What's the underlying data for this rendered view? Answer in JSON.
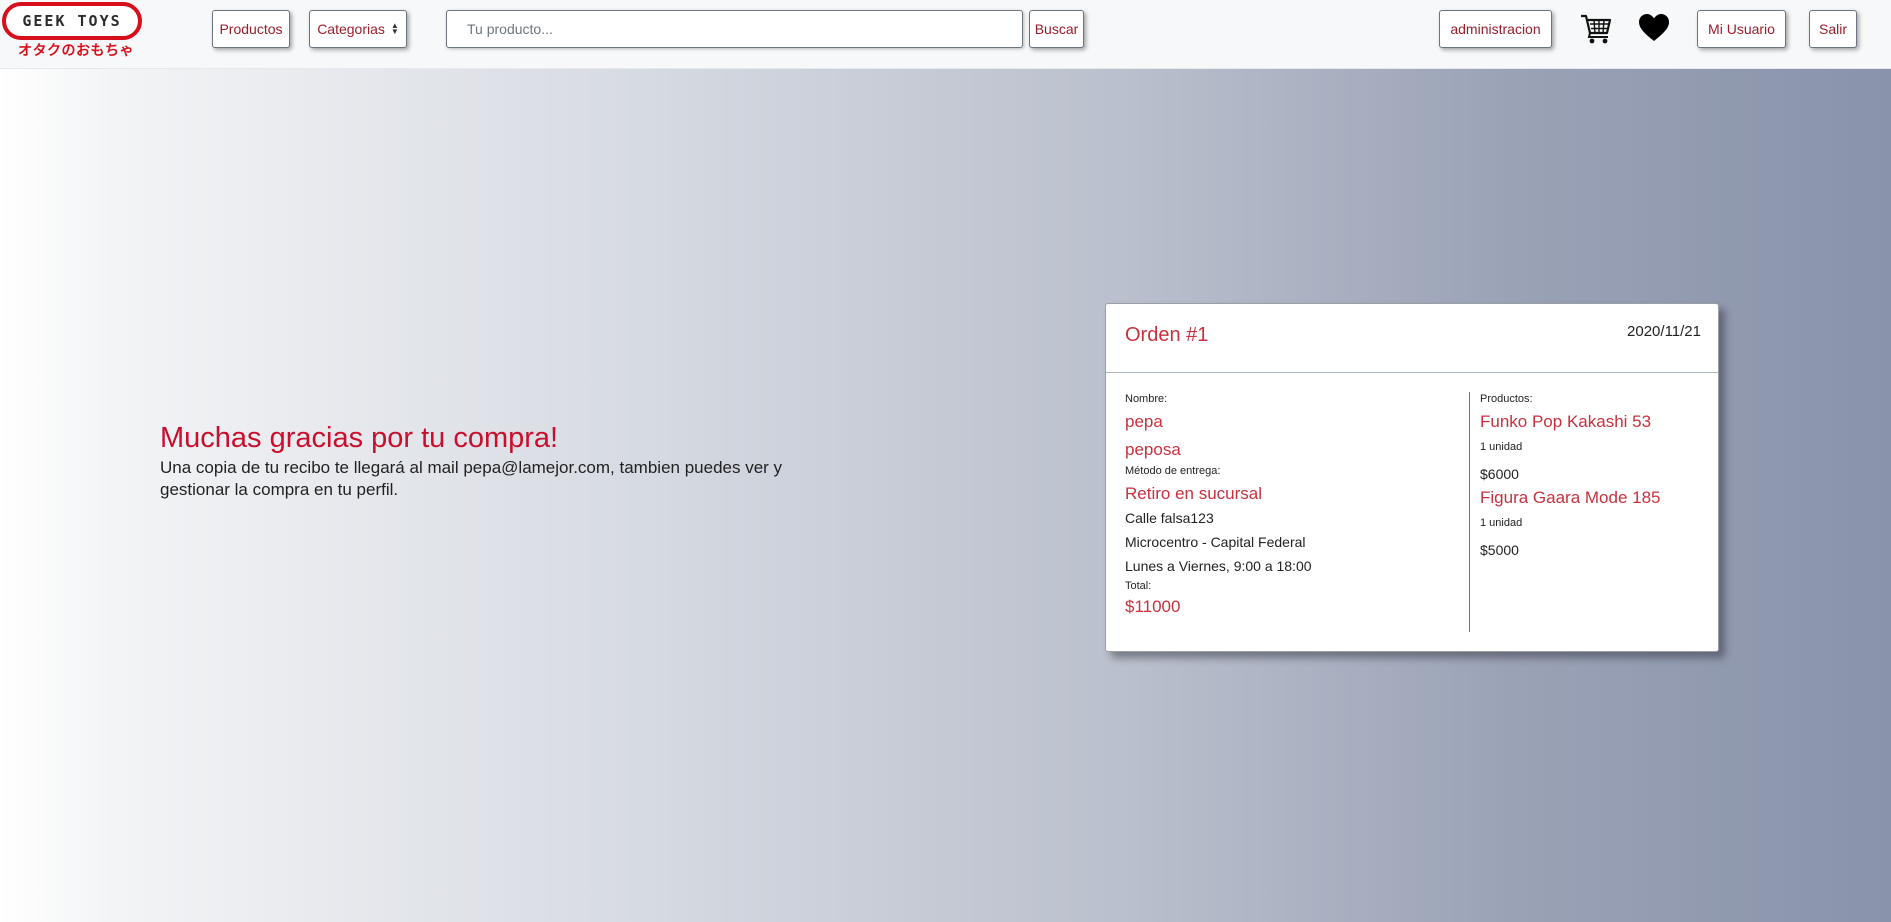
{
  "header": {
    "logo_text": "GEEK TOYS",
    "logo_subtitle": "オタクのおもちゃ",
    "products_label": "Productos",
    "categories_label": "Categorias",
    "search_placeholder": "Tu producto...",
    "search_button": "Buscar",
    "admin_label": "administracion",
    "cart_icon": "cart-icon",
    "favorites_icon": "heart-icon",
    "user_label": "Mi Usuario",
    "logout_label": "Salir"
  },
  "thanks": {
    "title": "Muchas gracias por tu compra!",
    "message": "Una copia de tu recibo te llegará al mail pepa@lamejor.com, tambien puedes ver y gestionar la compra en tu perfil."
  },
  "order": {
    "title": "Orden #1",
    "date": "2020/11/21",
    "name_label": "Nombre:",
    "first_name": "pepa",
    "last_name": "peposa",
    "delivery_label": "Método de entrega:",
    "delivery_method": "Retiro en sucursal",
    "address": "Calle falsa123",
    "area": "Microcentro - Capital Federal",
    "hours": "Lunes a Viernes, 9:00 a 18:00",
    "total_label": "Total:",
    "total": "$11000",
    "products_label": "Productos:",
    "products": [
      {
        "name": "Funko Pop Kakashi 53",
        "quantity": "1 unidad",
        "price": "$6000"
      },
      {
        "name": "Figura Gaara Mode 185",
        "quantity": "1 unidad",
        "price": "$5000"
      }
    ]
  },
  "colors": {
    "accent": "#c8313e",
    "brand_red": "#d80f1b",
    "button_text": "#9b1c2b"
  }
}
